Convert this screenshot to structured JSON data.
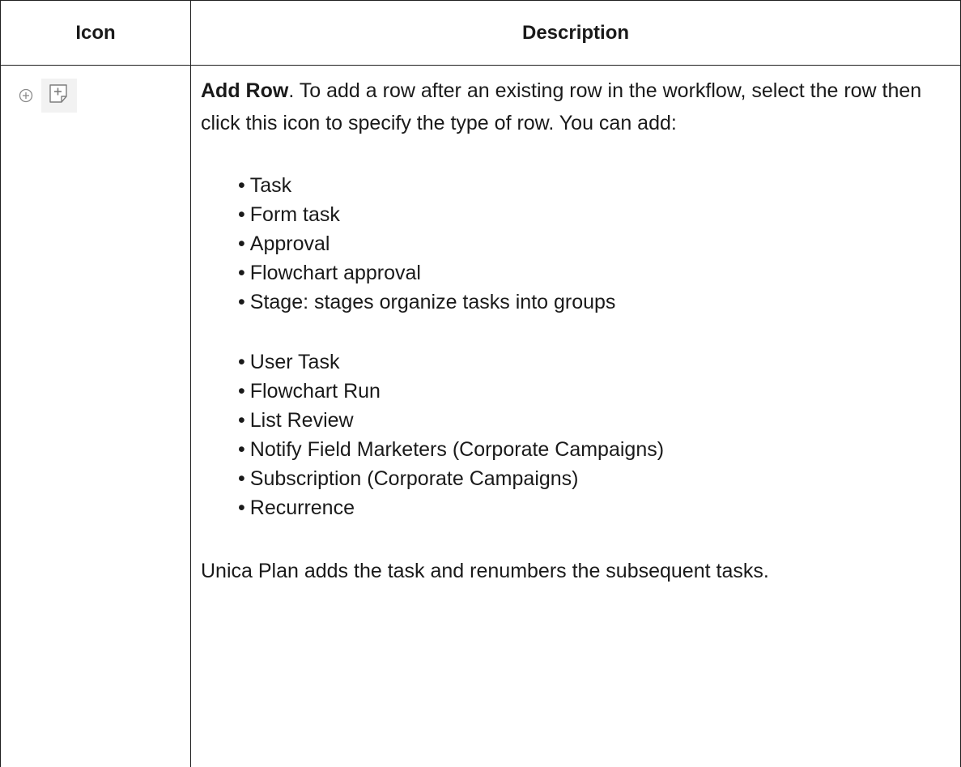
{
  "table": {
    "headers": {
      "icon": "Icon",
      "description": "Description"
    },
    "row": {
      "icons": [
        "add-circle-icon",
        "add-row-icon"
      ],
      "title": "Add Row",
      "intro": ". To add a row after an existing row in the workflow, select the row then click this icon to specify the type of row. You can add:",
      "list_a": [
        "Task",
        "Form task",
        "Approval",
        "Flowchart approval",
        "Stage: stages organize tasks into groups"
      ],
      "list_b": [
        "User Task",
        "Flowchart Run",
        "List Review",
        "Notify Field Marketers (Corporate Campaigns)",
        "Subscription (Corporate Campaigns)",
        "Recurrence"
      ],
      "closing": "Unica Plan adds the task and renumbers the subsequent tasks."
    }
  },
  "colors": {
    "border": "#1f1f1f",
    "text": "#1a1a1a",
    "icon_gray": "#8a8a8a",
    "icon_bg": "#f2f2f2"
  }
}
